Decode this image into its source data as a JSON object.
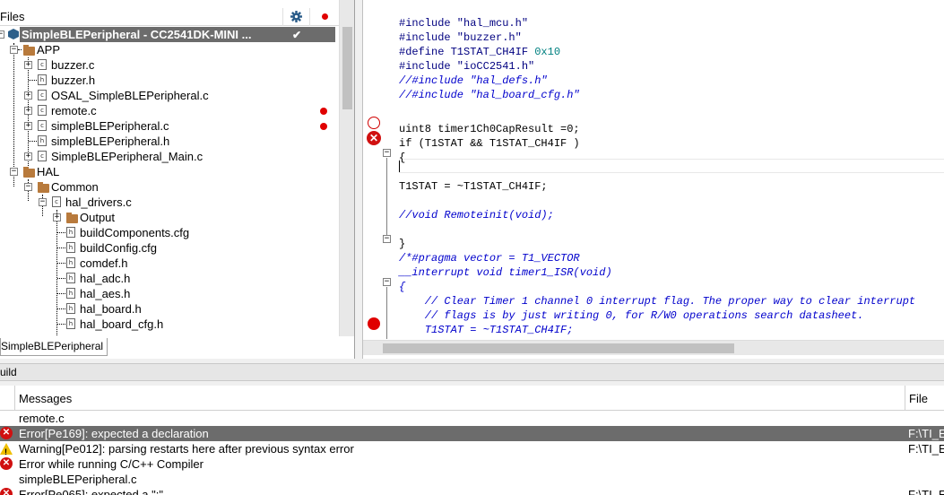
{
  "workspace": {
    "header_label": "Files",
    "tab_label": "SimpleBLEPeripheral",
    "tree": [
      {
        "label": "SimpleBLEPeripheral - CC2541DK-MINI ...",
        "type": "project",
        "selected": true
      },
      {
        "label": "APP",
        "type": "folder"
      },
      {
        "label": "buzzer.c",
        "type": "c-file"
      },
      {
        "label": "buzzer.h",
        "type": "h-file"
      },
      {
        "label": "OSAL_SimpleBLEPeripheral.c",
        "type": "c-file"
      },
      {
        "label": "remote.c",
        "type": "c-file",
        "error": true
      },
      {
        "label": "simpleBLEPeripheral.c",
        "type": "c-file",
        "error": true
      },
      {
        "label": "simpleBLEPeripheral.h",
        "type": "h-file"
      },
      {
        "label": "SimpleBLEPeripheral_Main.c",
        "type": "c-file"
      },
      {
        "label": "HAL",
        "type": "folder"
      },
      {
        "label": "Common",
        "type": "folder"
      },
      {
        "label": "hal_drivers.c",
        "type": "c-file"
      },
      {
        "label": "Output",
        "type": "folder"
      },
      {
        "label": "buildComponents.cfg",
        "type": "h-file"
      },
      {
        "label": "buildConfig.cfg",
        "type": "h-file"
      },
      {
        "label": "comdef.h",
        "type": "h-file"
      },
      {
        "label": "hal_adc.h",
        "type": "h-file"
      },
      {
        "label": "hal_aes.h",
        "type": "h-file"
      },
      {
        "label": "hal_board.h",
        "type": "h-file"
      },
      {
        "label": "hal_board_cfg.h",
        "type": "h-file"
      }
    ]
  },
  "editor": {
    "lines": [
      {
        "text": "#include \"hal_mcu.h\"",
        "style": "pp"
      },
      {
        "text": "#include \"buzzer.h\"",
        "style": "pp"
      },
      {
        "text": "#define T1STAT_CH4IF 0x10",
        "style": "define"
      },
      {
        "text": "#include \"ioCC2541.h\"",
        "style": "pp"
      },
      {
        "text": "//#include \"hal_defs.h\"",
        "style": "cmt"
      },
      {
        "text": "//#include \"hal_board_cfg.h\"",
        "style": "cmt"
      },
      {
        "text": "",
        "style": "plain"
      },
      {
        "text": "uint8 timer1Ch0CapResult =0;",
        "style": "plain"
      },
      {
        "text": "if (T1STAT && T1STAT_CH4IF )",
        "style": "plain"
      },
      {
        "text": "{",
        "style": "plain"
      },
      {
        "text": "",
        "style": "plain"
      },
      {
        "text": "T1STAT = ~T1STAT_CH4IF;",
        "style": "plain"
      },
      {
        "text": "",
        "style": "plain"
      },
      {
        "text": "//void Remoteinit(void);",
        "style": "cmt"
      },
      {
        "text": "",
        "style": "plain"
      },
      {
        "text": "}",
        "style": "plain"
      },
      {
        "text": "/*#pragma vector = T1_VECTOR",
        "style": "cmt"
      },
      {
        "text": "__interrupt void timer1_ISR(void)",
        "style": "cmt"
      },
      {
        "text": "{",
        "style": "cmt"
      },
      {
        "text": "    // Clear Timer 1 channel 0 interrupt flag. The proper way to clear interrupt",
        "style": "cmt"
      },
      {
        "text": "    // flags is by just writing 0, for R/W0 operations search datasheet.",
        "style": "cmt"
      },
      {
        "text": "    T1STAT = ~T1STAT_CH4IF;",
        "style": "cmt"
      }
    ]
  },
  "build": {
    "title": "uild",
    "col_messages": "Messages",
    "col_file": "File",
    "rows": [
      {
        "kind": "none",
        "message": "remote.c",
        "file": ""
      },
      {
        "kind": "error",
        "message": "Error[Pe169]: expected a declaration",
        "file": "F:\\TI_E",
        "selected": true
      },
      {
        "kind": "warning",
        "message": "Warning[Pe012]: parsing restarts here after previous syntax error",
        "file": "F:\\TI_E"
      },
      {
        "kind": "error",
        "message": "Error while running C/C++ Compiler",
        "file": ""
      },
      {
        "kind": "none",
        "message": "simpleBLEPeripheral.c",
        "file": ""
      },
      {
        "kind": "error",
        "message": "Error[Pe065]: expected a \";\"",
        "file": "F:\\TI_E"
      }
    ]
  },
  "colors": {
    "selection": "#6c6c6c",
    "error_red": "#d01010",
    "comment_blue": "#0000cc",
    "number_teal": "#008080"
  }
}
